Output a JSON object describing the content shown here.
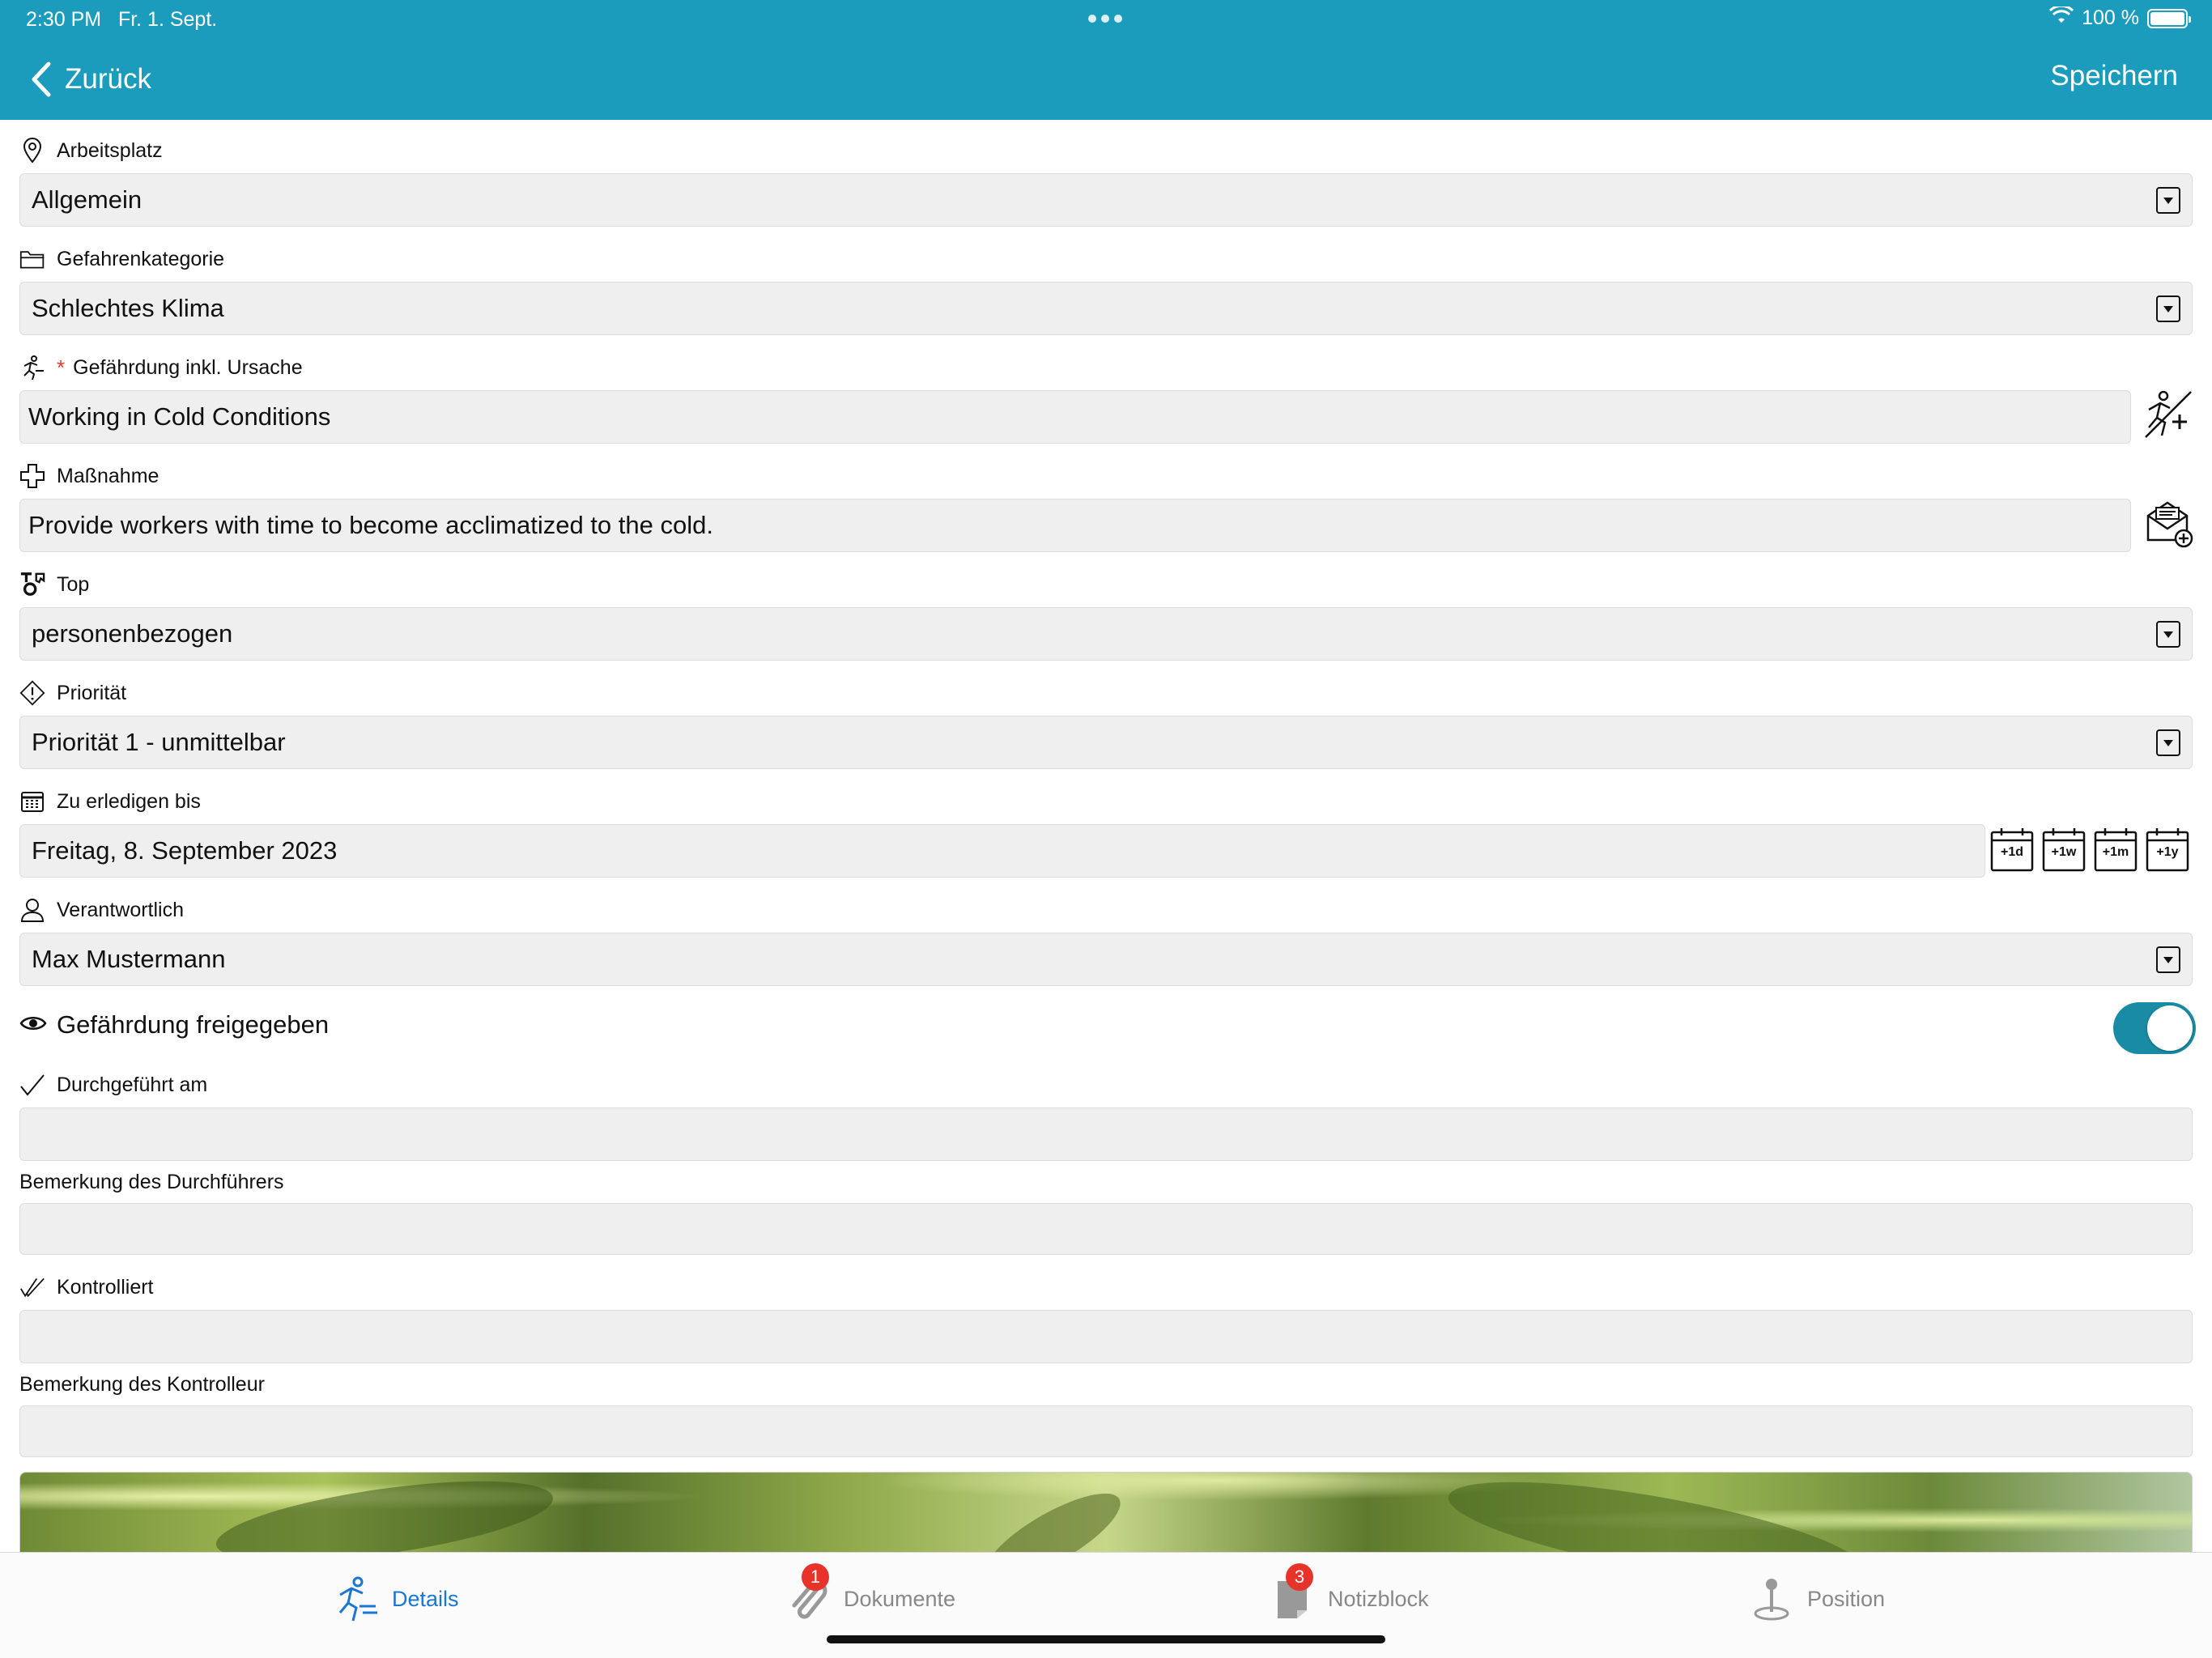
{
  "status_bar": {
    "time": "2:30 PM",
    "date": "Fr. 1. Sept.",
    "battery": "100 %"
  },
  "nav": {
    "back_label": "Zurück",
    "save_label": "Speichern"
  },
  "form": {
    "arbeitsplatz": {
      "label": "Arbeitsplatz",
      "value": "Allgemein"
    },
    "gefahrenkategorie": {
      "label": "Gefahrenkategorie",
      "value": "Schlechtes Klima"
    },
    "gefaehrdung": {
      "label": "Gefährdung inkl. Ursache",
      "required_mark": "*",
      "value": "Working in Cold Conditions"
    },
    "massnahme": {
      "label": "Maßnahme",
      "value": "Provide workers with time to become acclimatized to the cold."
    },
    "top": {
      "label": "Top",
      "value": "personenbezogen"
    },
    "prioritaet": {
      "label": "Priorität",
      "value": "Priorität 1 - unmittelbar"
    },
    "zu_erledigen": {
      "label": "Zu erledigen bis",
      "value": "Freitag, 8. September 2023",
      "quick_buttons": [
        "+1d",
        "+1w",
        "+1m",
        "+1y"
      ]
    },
    "verantwortlich": {
      "label": "Verantwortlich",
      "value": "Max Mustermann"
    },
    "freigegeben": {
      "label": "Gefährdung freigegeben",
      "enabled": true
    },
    "durchgefuehrt": {
      "label": "Durchgeführt am",
      "value": ""
    },
    "bemerkung_durchfuehrer": {
      "label": "Bemerkung des Durchführers",
      "value": ""
    },
    "kontrolliert": {
      "label": "Kontrolliert",
      "value": ""
    },
    "bemerkung_kontrolleur": {
      "label": "Bemerkung des Kontrolleur",
      "value": ""
    }
  },
  "tabs": [
    {
      "label": "Details",
      "icon": "hazard-person-icon",
      "active": true
    },
    {
      "label": "Dokumente",
      "icon": "paperclip-icon",
      "badge": "1"
    },
    {
      "label": "Notizblock",
      "icon": "notepad-icon",
      "badge": "3"
    },
    {
      "label": "Position",
      "icon": "map-pin-icon"
    }
  ],
  "colors": {
    "header": "#1c9cbc",
    "toggle_on": "#1a8ba5",
    "tab_active": "#1a76d2",
    "badge": "#e8332a"
  }
}
